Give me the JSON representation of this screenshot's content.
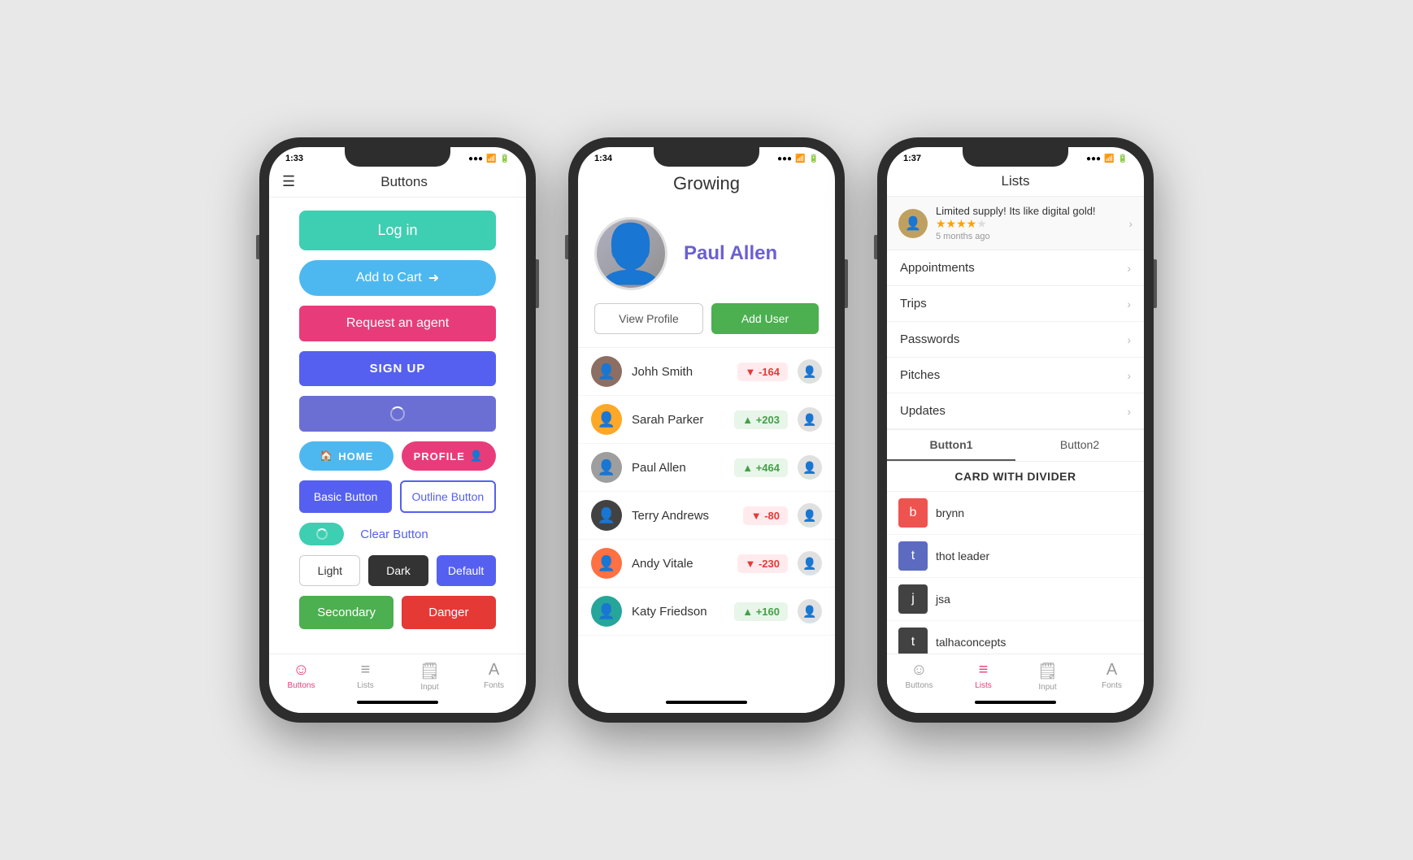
{
  "phone1": {
    "time": "1:33",
    "title": "Buttons",
    "buttons": {
      "login": "Log in",
      "cart": "Add to Cart",
      "agent": "Request an agent",
      "signup": "SIGN UP",
      "home": "HOME",
      "profile": "PROFILE",
      "basic": "Basic Button",
      "outline": "Outline Button",
      "clear": "Clear Button",
      "light": "Light",
      "dark": "Dark",
      "default": "Default",
      "secondary": "Secondary",
      "danger": "Danger"
    },
    "tabs": [
      "Buttons",
      "Lists",
      "Input",
      "Fonts"
    ]
  },
  "phone2": {
    "time": "1:34",
    "app_title": "Growing",
    "profile_name": "Paul Allen",
    "view_profile": "View Profile",
    "add_user": "Add User",
    "users": [
      {
        "name": "Johh Smith",
        "score": "-164",
        "positive": false
      },
      {
        "name": "Sarah Parker",
        "score": "+203",
        "positive": true
      },
      {
        "name": "Paul Allen",
        "score": "+464",
        "positive": true
      },
      {
        "name": "Terry Andrews",
        "score": "-80",
        "positive": false
      },
      {
        "name": "Andy Vitale",
        "score": "-230",
        "positive": false
      },
      {
        "name": "Katy Friedson",
        "score": "+160",
        "positive": true
      }
    ]
  },
  "phone3": {
    "time": "1:37",
    "title": "Lists",
    "review": {
      "text": "Limited supply! Its like digital gold!",
      "time": "5 months ago",
      "stars": 4
    },
    "nav_items": [
      "Appointments",
      "Trips",
      "Passwords",
      "Pitches",
      "Updates"
    ],
    "tab_buttons": [
      "Button1",
      "Button2"
    ],
    "card_title": "CARD WITH DIVIDER",
    "card_users": [
      "brynn",
      "thot leader",
      "jsa",
      "talhaconcepts"
    ],
    "tabs": [
      "Buttons",
      "Lists",
      "Input",
      "Fonts"
    ]
  }
}
